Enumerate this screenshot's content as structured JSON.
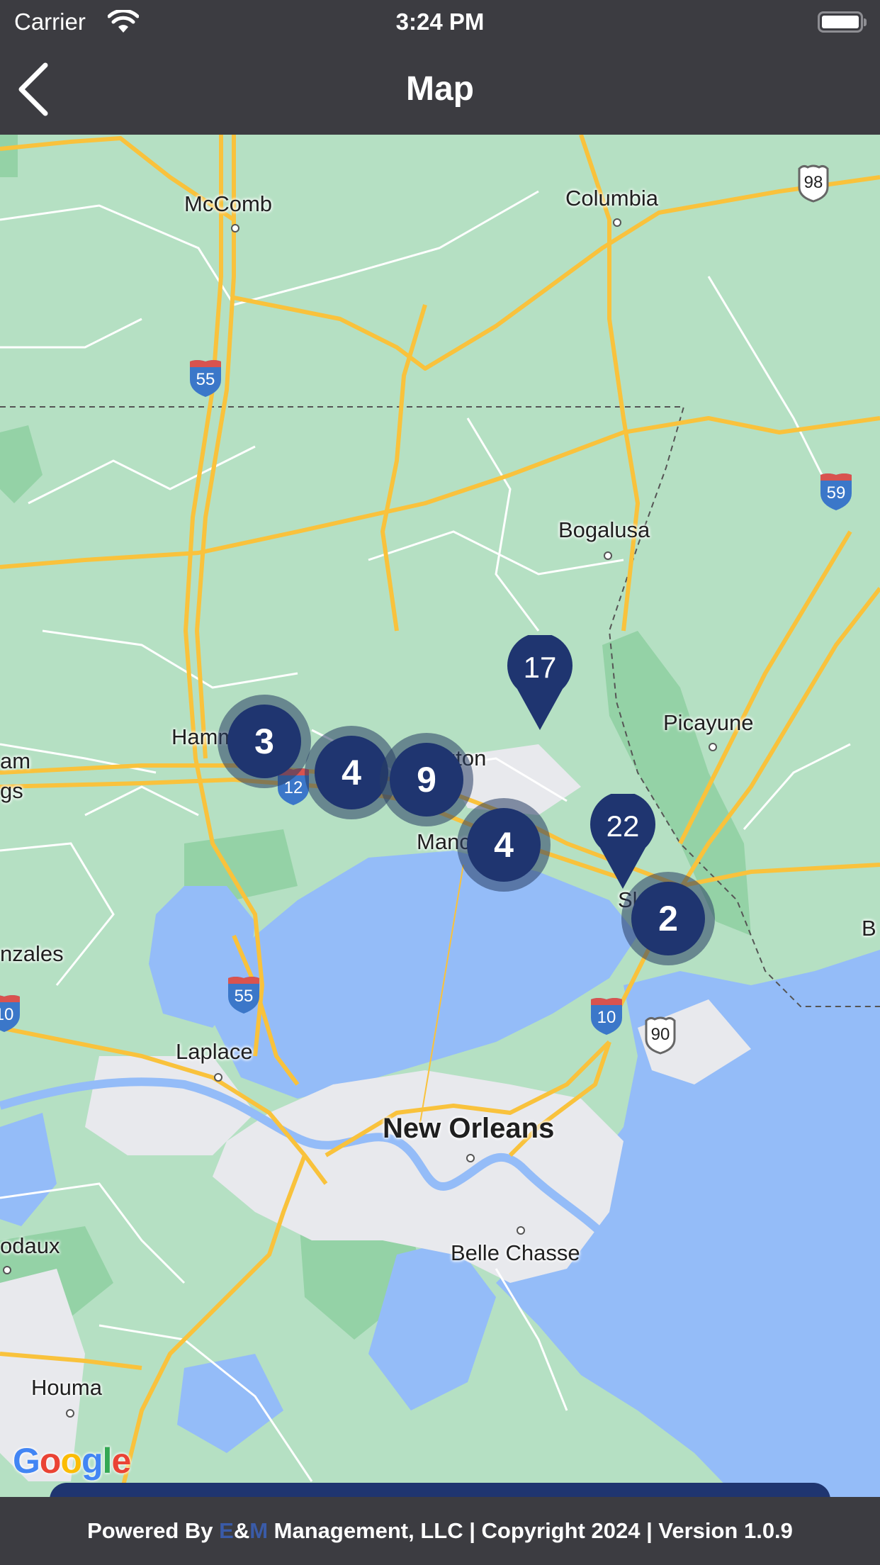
{
  "status_bar": {
    "carrier": "Carrier",
    "time": "3:24 PM",
    "wifi_icon": "wifi-icon",
    "battery_icon": "battery-icon"
  },
  "nav": {
    "title": "Map",
    "back_icon": "chevron-left-icon"
  },
  "map": {
    "provider_logo": "Google",
    "colors": {
      "land": "#b5e0c3",
      "forest": "#94d2a6",
      "water": "#94bcf8",
      "urban": "#e8e9ed",
      "highway": "#f9c23c",
      "marker": "#1f3570"
    },
    "labels": [
      {
        "name": "McComb",
        "big": false
      },
      {
        "name": "Columbia",
        "big": false
      },
      {
        "name": "Bogalusa",
        "big": false
      },
      {
        "name": "Picayune",
        "big": false
      },
      {
        "name": "Hamm",
        "big": false
      },
      {
        "name": "gton",
        "big": false
      },
      {
        "name": "Manc",
        "big": false
      },
      {
        "name": "Sl",
        "big": false
      },
      {
        "name": "am",
        "big": false
      },
      {
        "name": "gs",
        "big": false
      },
      {
        "name": "nzales",
        "big": false
      },
      {
        "name": "Laplace",
        "big": false
      },
      {
        "name": "New Orleans",
        "big": true
      },
      {
        "name": "Belle Chasse",
        "big": false
      },
      {
        "name": "odaux",
        "big": false
      },
      {
        "name": "Houma",
        "big": false
      },
      {
        "name": "B",
        "big": false
      }
    ],
    "shields": [
      {
        "type": "interstate",
        "number": "55"
      },
      {
        "type": "interstate",
        "number": "59"
      },
      {
        "type": "interstate",
        "number": "12"
      },
      {
        "type": "interstate",
        "number": "55"
      },
      {
        "type": "interstate",
        "number": "10"
      },
      {
        "type": "interstate",
        "number": "10"
      },
      {
        "type": "us",
        "number": "98"
      },
      {
        "type": "us",
        "number": "90"
      }
    ],
    "clusters": [
      {
        "count": "3"
      },
      {
        "count": "4"
      },
      {
        "count": "9"
      },
      {
        "count": "4"
      },
      {
        "count": "2"
      }
    ],
    "pins": [
      {
        "count": "17"
      },
      {
        "count": "22"
      }
    ]
  },
  "footer": {
    "prefix": "Powered By ",
    "brand_e": "E",
    "brand_amp": "&",
    "brand_m": "M",
    "suffix": " Management, LLC | Copyright 2024 | Version 1.0.9"
  }
}
